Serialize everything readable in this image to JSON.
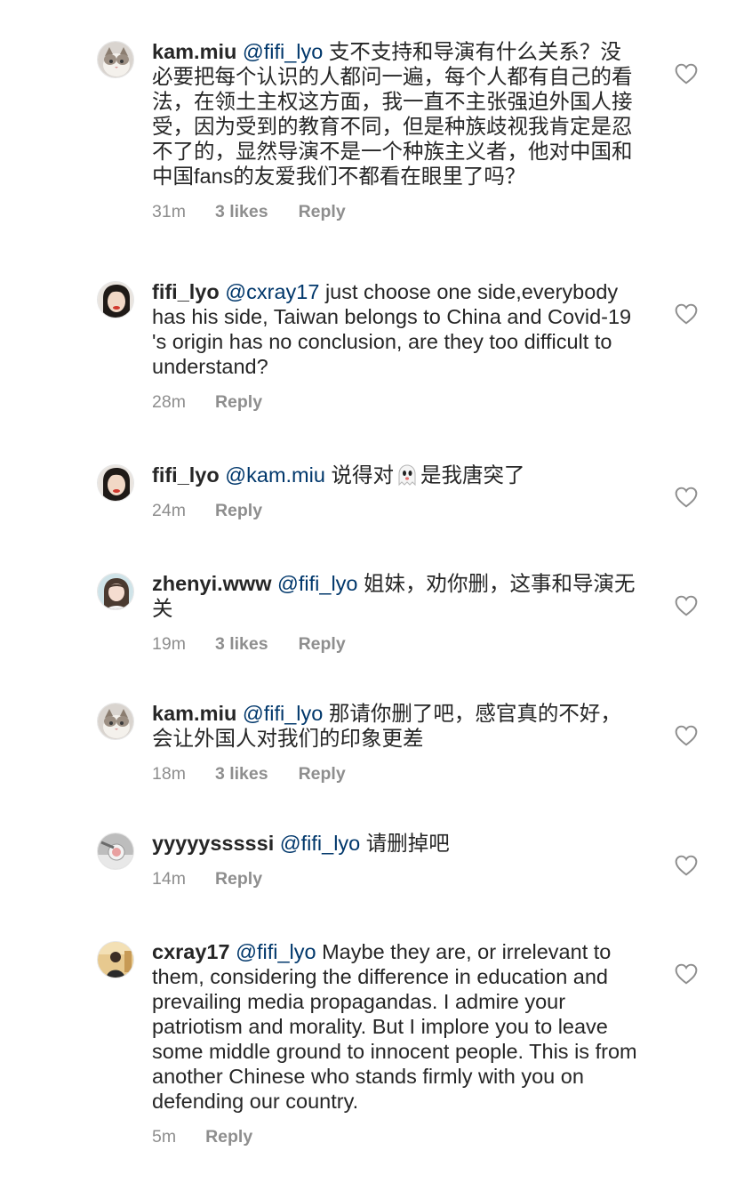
{
  "comments": [
    {
      "username": "kam.miu",
      "mention": "@fifi_lyo",
      "text": "支不支持和导演有什么关系？没必要把每个认识的人都问一遍，每个人都有自己的看法，在领土主权这方面，我一直不主张强迫外国人接受，因为受到的教育不同，但是种族歧视我肯定是忍不了的，显然导演不是一个种族主义者，他对中国和中国fans的友爱我们不都看在眼里了吗？",
      "time": "31m",
      "likes": "3 likes",
      "reply": "Reply"
    },
    {
      "username": "fifi_lyo",
      "mention": "@cxray17",
      "text": "just choose one side,everybody has his side, Taiwan belongs to China and Covid-19 's origin has no conclusion, are they too difficult to understand?",
      "time": "28m",
      "likes": "",
      "reply": "Reply"
    },
    {
      "username": "fifi_lyo",
      "mention": "@kam.miu",
      "text_before": "说得对",
      "emoji": "ghost-emoji",
      "text_after": "是我唐突了",
      "time": "24m",
      "likes": "",
      "reply": "Reply"
    },
    {
      "username": "zhenyi.www",
      "mention": "@fifi_lyo",
      "text": "姐妹，劝你删，这事和导演无关",
      "time": "19m",
      "likes": "3 likes",
      "reply": "Reply"
    },
    {
      "username": "kam.miu",
      "mention": "@fifi_lyo",
      "text": "那请你删了吧，感官真的不好，会让外国人对我们的印象更差",
      "time": "18m",
      "likes": "3 likes",
      "reply": "Reply"
    },
    {
      "username": "yyyyysssssi",
      "mention": "@fifi_lyo",
      "text": "请删掉吧",
      "time": "14m",
      "likes": "",
      "reply": "Reply"
    },
    {
      "username": "cxray17",
      "mention": "@fifi_lyo",
      "text": "Maybe they are, or irrelevant to them, considering the difference in education and prevailing media propagandas. I admire your patriotism and morality. But I implore you to leave some middle ground to innocent people. This is from another Chinese who stands firmly with you on defending our country.",
      "time": "5m",
      "likes": "",
      "reply": "Reply"
    }
  ],
  "icons": {
    "like": "heart-outline-icon"
  },
  "colors": {
    "username": "#262626",
    "mention": "#00376b",
    "meta": "#8e8e8e",
    "background": "#ffffff"
  }
}
